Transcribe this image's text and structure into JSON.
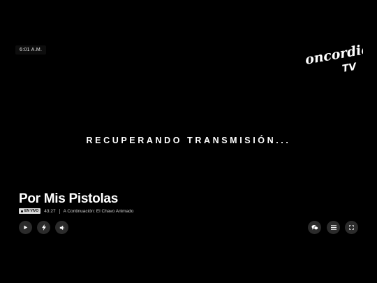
{
  "player": {
    "clock": "6:01 A.M.",
    "status_message": "RECUPERANDO TRANSMISIÓN...",
    "program_title": "Por Mis Pistolas",
    "live_badge": "EN VIVO",
    "elapsed": "43:27",
    "up_next": "A Continuación: El Chavo Animado"
  },
  "logo": {
    "line1": "Concordia",
    "line2": "TV"
  },
  "controls": {
    "left": [
      "play-icon",
      "lightning-icon",
      "volume-icon"
    ],
    "right": [
      "chat-icon",
      "menu-icon",
      "fullscreen-icon"
    ]
  },
  "colors": {
    "background": "#000000",
    "button": "#2b2b2b",
    "text": "#ffffff",
    "badge": "#d9d9d9"
  }
}
